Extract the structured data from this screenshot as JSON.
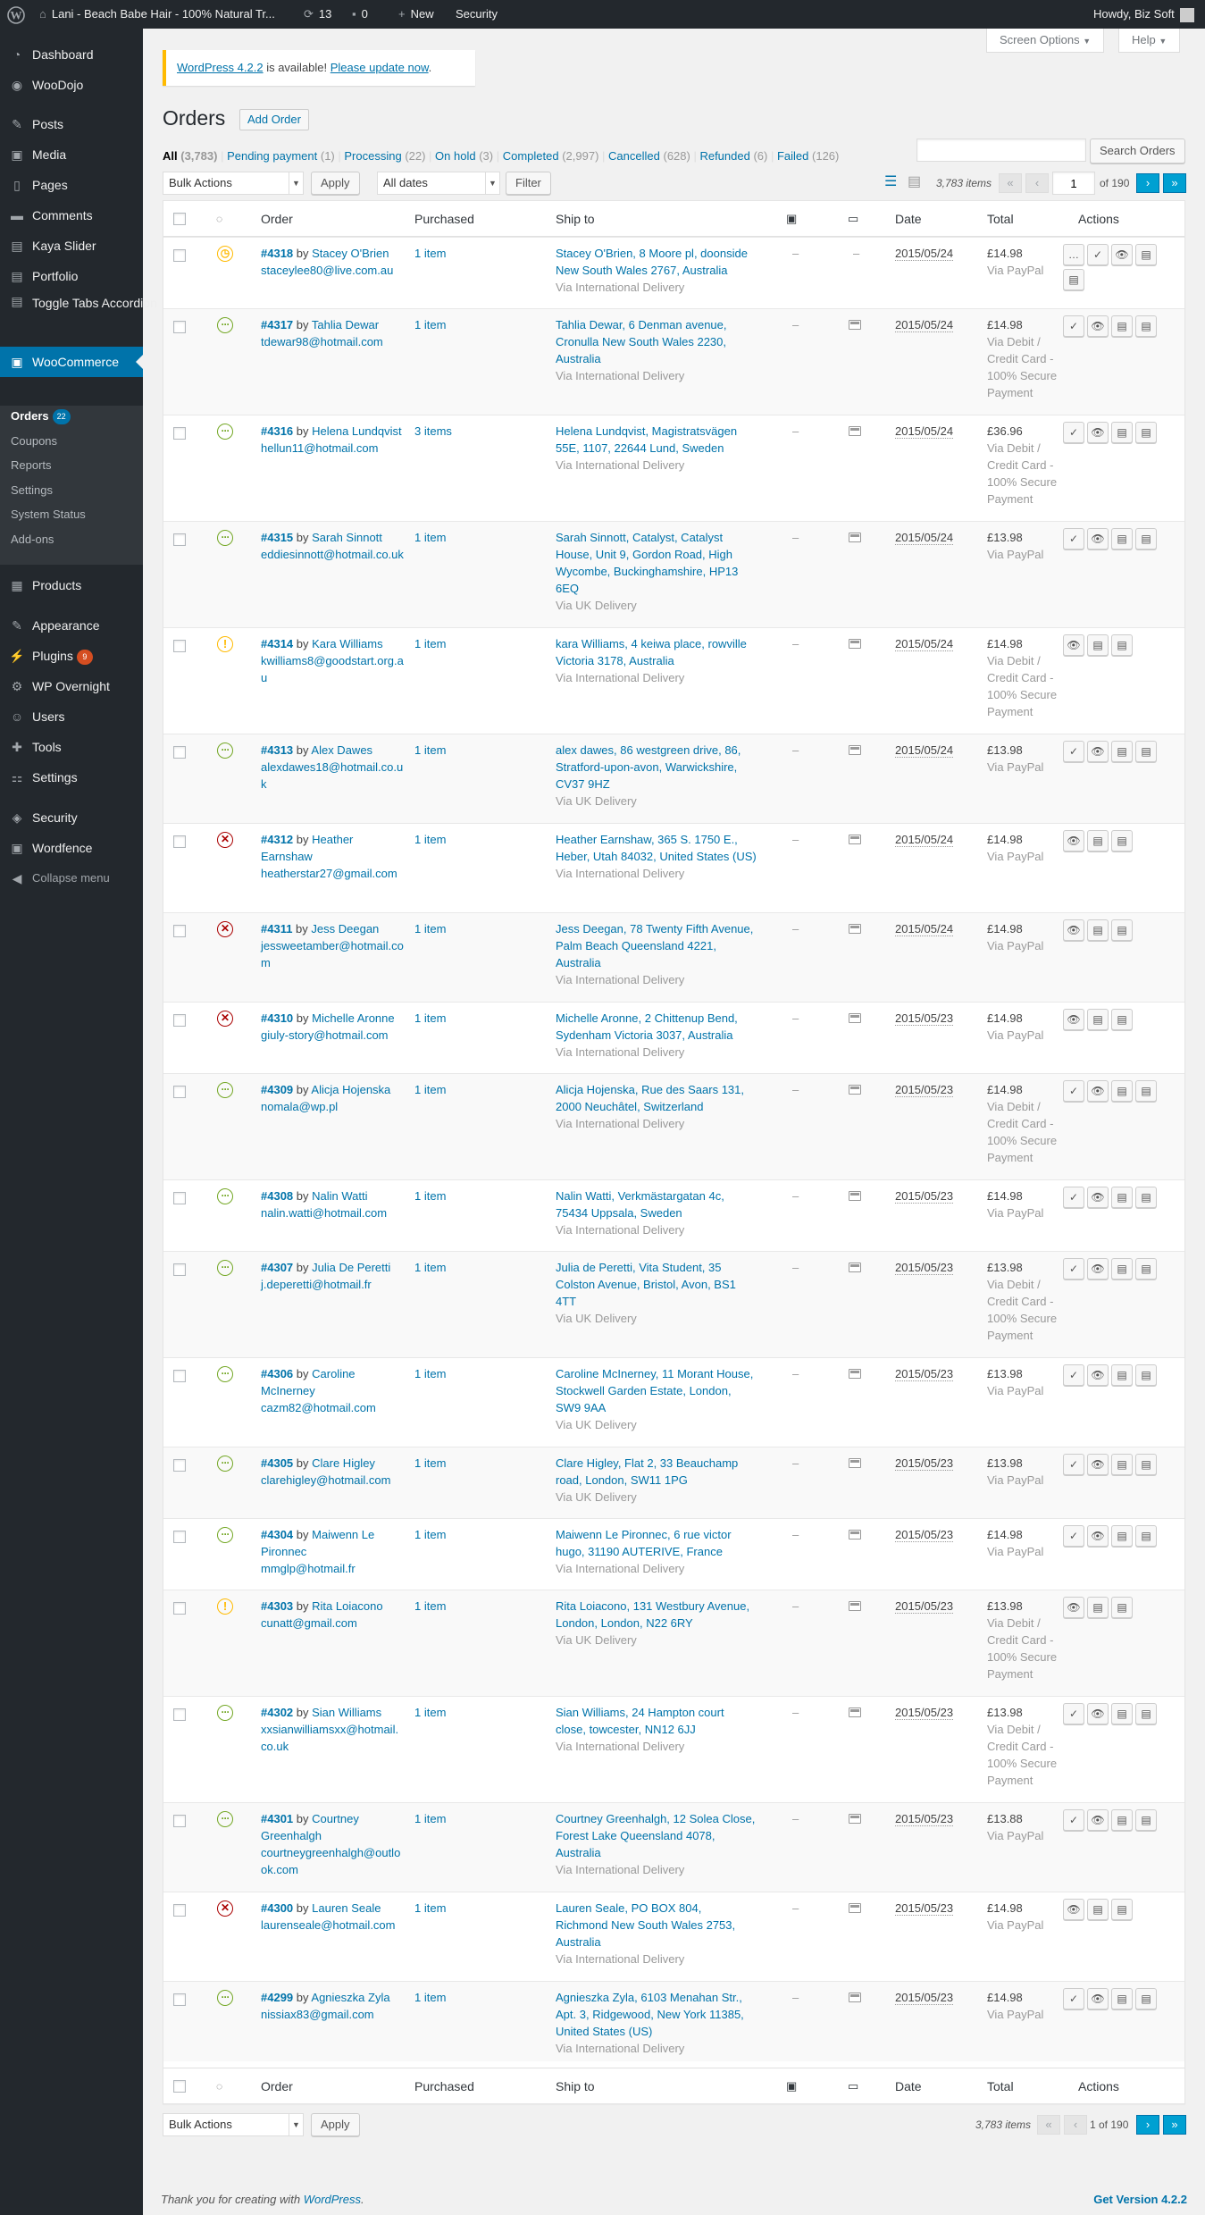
{
  "adminbar": {
    "site_name": "Lani - Beach Babe Hair - 100% Natural Tr...",
    "updates_count": "13",
    "comments_count": "0",
    "new_label": "New",
    "security_label": "Security",
    "howdy": "Howdy, Biz Soft"
  },
  "sidebar": {
    "dashboard": "Dashboard",
    "woodojo": "WooDojo",
    "posts": "Posts",
    "media": "Media",
    "pages": "Pages",
    "comments": "Comments",
    "kaya": "Kaya Slider",
    "portfolio": "Portfolio",
    "toggle_tabs": "Toggle Tabs Accordion",
    "woocommerce": "WooCommerce",
    "sub_orders": "Orders",
    "sub_orders_badge": "22",
    "sub_coupons": "Coupons",
    "sub_reports": "Reports",
    "sub_settings": "Settings",
    "sub_system": "System Status",
    "sub_addons": "Add-ons",
    "products": "Products",
    "appearance": "Appearance",
    "plugins": "Plugins",
    "plugins_badge": "9",
    "overnight": "WP Overnight",
    "users": "Users",
    "tools": "Tools",
    "settings": "Settings",
    "security": "Security",
    "wordfence": "Wordfence",
    "collapse": "Collapse menu"
  },
  "top": {
    "screen_options": "Screen Options",
    "help": "Help"
  },
  "notice": {
    "version_link": "WordPress 4.2.2",
    "text": " is available! ",
    "update_link": "Please update now",
    "end": "."
  },
  "page": {
    "title": "Orders",
    "add_order": "Add Order"
  },
  "filters": {
    "all": "All",
    "all_count": "(3,783)",
    "pending": "Pending payment",
    "pending_count": "(1)",
    "processing": "Processing",
    "processing_count": "(22)",
    "onhold": "On hold",
    "onhold_count": "(3)",
    "completed": "Completed",
    "completed_count": "(2,997)",
    "cancelled": "Cancelled",
    "cancelled_count": "(628)",
    "refunded": "Refunded",
    "refunded_count": "(6)",
    "failed": "Failed",
    "failed_count": "(126)"
  },
  "search": {
    "placeholder": "",
    "button": "Search Orders"
  },
  "toolbar": {
    "bulk_actions": "Bulk Actions",
    "apply": "Apply",
    "all_dates": "All dates",
    "filter": "Filter",
    "items": "3,783 items",
    "current_page": "1",
    "of_pages": "of 190",
    "bottom_pages": "1 of 190"
  },
  "columns": {
    "order": "Order",
    "purchased": "Purchased",
    "ship_to": "Ship to",
    "date": "Date",
    "total": "Total",
    "actions": "Actions"
  },
  "orders": [
    {
      "num": "#4318",
      "by": " by ",
      "name": "Stacey O'Brien",
      "email": "staceylee80@live.com.au",
      "purchased": "1 item",
      "ship": "Stacey O'Brien, 8 Moore pl, doonside New South Wales 2767, Australia",
      "via": "Via International Delivery",
      "date": "2015/05/24",
      "total": "£14.98",
      "method": "Via PayPal",
      "status": "pending",
      "icon": "◷",
      "note": "–",
      "actions": [
        "…",
        "✓",
        "👁",
        "▤",
        "▤"
      ]
    },
    {
      "num": "#4317",
      "by": " by ",
      "name": "Tahlia Dewar",
      "email": "tdewar98@hotmail.com",
      "purchased": "1 item",
      "ship": "Tahlia Dewar, 6 Denman avenue, Cronulla New South Wales 2230, Australia",
      "via": "Via International Delivery",
      "date": "2015/05/24",
      "total": "£14.98",
      "method": "Via Debit / Credit Card - 100% Secure Payment",
      "status": "processing",
      "icon": "···",
      "note": "icon",
      "actions": [
        "✓",
        "👁",
        "▤",
        "▤"
      ]
    },
    {
      "num": "#4316",
      "by": " by ",
      "name": "Helena Lundqvist",
      "email": "hellun11@hotmail.com",
      "purchased": "3 items",
      "ship": "Helena Lundqvist, Magistratsvägen 55E, 1107, 22644 Lund, Sweden",
      "via": "Via International Delivery",
      "date": "2015/05/24",
      "total": "£36.96",
      "method": "Via Debit / Credit Card - 100% Secure Payment",
      "status": "processing",
      "icon": "···",
      "note": "icon",
      "actions": [
        "✓",
        "👁",
        "▤",
        "▤"
      ]
    },
    {
      "num": "#4315",
      "by": " by ",
      "name": "Sarah Sinnott",
      "email": "eddiesinnott@hotmail.co.uk",
      "purchased": "1 item",
      "ship": "Sarah Sinnott, Catalyst, Catalyst House, Unit 9, Gordon Road, High Wycombe, Buckinghamshire, HP13 6EQ",
      "via": "Via UK Delivery",
      "date": "2015/05/24",
      "total": "£13.98",
      "method": "Via PayPal",
      "status": "processing",
      "icon": "···",
      "note": "icon",
      "actions": [
        "✓",
        "👁",
        "▤",
        "▤"
      ]
    },
    {
      "num": "#4314",
      "by": " by ",
      "name": "Kara Williams",
      "email": "kwilliams8@goodstart.org.au",
      "purchased": "1 item",
      "ship": "kara Williams, 4 keiwa place, rowville Victoria 3178, Australia",
      "via": "Via International Delivery",
      "date": "2015/05/24",
      "total": "£14.98",
      "method": "Via Debit / Credit Card - 100% Secure Payment",
      "status": "pay",
      "icon": "!",
      "note": "icon",
      "actions": [
        "👁",
        "▤",
        "▤"
      ]
    },
    {
      "num": "#4313",
      "by": " by ",
      "name": "Alex Dawes",
      "email": "alexdawes18@hotmail.co.uk",
      "purchased": "1 item",
      "ship": "alex dawes, 86 westgreen drive, 86, Stratford-upon-avon, Warwickshire, CV37 9HZ",
      "via": "Via UK Delivery",
      "date": "2015/05/24",
      "total": "£13.98",
      "method": "Via PayPal",
      "status": "processing",
      "icon": "···",
      "note": "icon",
      "actions": [
        "✓",
        "👁",
        "▤",
        "▤"
      ]
    },
    {
      "num": "#4312",
      "by": " by ",
      "name": "Heather Earnshaw",
      "email": "heatherstar27@gmail.com",
      "purchased": "1 item",
      "ship": "Heather Earnshaw, 365 S. 1750 E., Heber, Utah 84032, United States (US)",
      "via": "Via International Delivery",
      "date": "2015/05/24",
      "total": "£14.98",
      "method": "Via PayPal",
      "status": "cancelled",
      "icon": "✕",
      "note": "icon",
      "actions": [
        "👁",
        "▤",
        "▤"
      ]
    },
    {
      "num": "#4311",
      "by": " by ",
      "name": "Jess Deegan",
      "email": "jessweetamber@hotmail.com",
      "purchased": "1 item",
      "ship": "Jess Deegan, 78 Twenty Fifth Avenue, Palm Beach Queensland 4221, Australia",
      "via": "Via International Delivery",
      "date": "2015/05/24",
      "total": "£14.98",
      "method": "Via PayPal",
      "status": "cancelled",
      "icon": "✕",
      "note": "icon",
      "actions": [
        "👁",
        "▤",
        "▤"
      ]
    },
    {
      "num": "#4310",
      "by": " by ",
      "name": "Michelle Aronne",
      "email": "giuly-story@hotmail.com",
      "purchased": "1 item",
      "ship": "Michelle Aronne, 2 Chittenup Bend, Sydenham Victoria 3037, Australia",
      "via": "Via International Delivery",
      "date": "2015/05/23",
      "total": "£14.98",
      "method": "Via PayPal",
      "status": "cancelled",
      "icon": "✕",
      "note": "icon",
      "actions": [
        "👁",
        "▤",
        "▤"
      ]
    },
    {
      "num": "#4309",
      "by": " by ",
      "name": "Alicja Hojenska",
      "email": "nomala@wp.pl",
      "purchased": "1 item",
      "ship": "Alicja Hojenska, Rue des Saars 131, 2000 Neuchâtel, Switzerland",
      "via": "Via International Delivery",
      "date": "2015/05/23",
      "total": "£14.98",
      "method": "Via Debit / Credit Card - 100% Secure Payment",
      "status": "processing",
      "icon": "···",
      "note": "icon",
      "actions": [
        "✓",
        "👁",
        "▤",
        "▤"
      ]
    },
    {
      "num": "#4308",
      "by": " by ",
      "name": "Nalin Watti",
      "email": "nalin.watti@hotmail.com",
      "purchased": "1 item",
      "ship": "Nalin Watti, Verkmästargatan 4c, 75434 Uppsala, Sweden",
      "via": "Via International Delivery",
      "date": "2015/05/23",
      "total": "£14.98",
      "method": "Via PayPal",
      "status": "processing",
      "icon": "···",
      "note": "icon",
      "actions": [
        "✓",
        "👁",
        "▤",
        "▤"
      ]
    },
    {
      "num": "#4307",
      "by": " by ",
      "name": "Julia De Peretti",
      "email": "j.deperetti@hotmail.fr",
      "purchased": "1 item",
      "ship": "Julia de Peretti, Vita Student, 35 Colston Avenue, Bristol, Avon, BS1 4TT",
      "via": "Via UK Delivery",
      "date": "2015/05/23",
      "total": "£13.98",
      "method": "Via Debit / Credit Card - 100% Secure Payment",
      "status": "processing",
      "icon": "···",
      "note": "icon",
      "actions": [
        "✓",
        "👁",
        "▤",
        "▤"
      ]
    },
    {
      "num": "#4306",
      "by": " by ",
      "name": "Caroline McInerney",
      "email": "cazm82@hotmail.com",
      "purchased": "1 item",
      "ship": "Caroline McInerney, 11 Morant House, Stockwell Garden Estate, London, SW9 9AA",
      "via": "Via UK Delivery",
      "date": "2015/05/23",
      "total": "£13.98",
      "method": "Via PayPal",
      "status": "processing",
      "icon": "···",
      "note": "icon",
      "actions": [
        "✓",
        "👁",
        "▤",
        "▤"
      ]
    },
    {
      "num": "#4305",
      "by": " by ",
      "name": "Clare Higley",
      "email": "clarehigley@hotmail.com",
      "purchased": "1 item",
      "ship": "Clare Higley, Flat 2, 33 Beauchamp road, London, SW11 1PG",
      "via": "Via UK Delivery",
      "date": "2015/05/23",
      "total": "£13.98",
      "method": "Via PayPal",
      "status": "processing",
      "icon": "···",
      "note": "icon",
      "actions": [
        "✓",
        "👁",
        "▤",
        "▤"
      ]
    },
    {
      "num": "#4304",
      "by": " by ",
      "name": "Maiwenn Le Pironnec",
      "email": "mmglp@hotmail.fr",
      "purchased": "1 item",
      "ship": "Maiwenn Le Pironnec, 6 rue victor hugo, 31190 AUTERIVE, France",
      "via": "Via International Delivery",
      "date": "2015/05/23",
      "total": "£14.98",
      "method": "Via PayPal",
      "status": "processing",
      "icon": "···",
      "note": "icon",
      "actions": [
        "✓",
        "👁",
        "▤",
        "▤"
      ]
    },
    {
      "num": "#4303",
      "by": " by ",
      "name": "Rita Loiacono",
      "email": "cunatt@gmail.com",
      "purchased": "1 item",
      "ship": "Rita Loiacono, 131 Westbury Avenue, London, London, N22 6RY",
      "via": "Via UK Delivery",
      "date": "2015/05/23",
      "total": "£13.98",
      "method": "Via Debit / Credit Card - 100% Secure Payment",
      "status": "pay",
      "icon": "!",
      "note": "icon",
      "actions": [
        "👁",
        "▤",
        "▤"
      ]
    },
    {
      "num": "#4302",
      "by": " by ",
      "name": "Sian Williams",
      "email": "xxsianwilliamsxx@hotmail.co.uk",
      "purchased": "1 item",
      "ship": "Sian Williams, 24 Hampton court close, towcester, NN12 6JJ",
      "via": "Via International Delivery",
      "date": "2015/05/23",
      "total": "£13.98",
      "method": "Via Debit / Credit Card - 100% Secure Payment",
      "status": "processing",
      "icon": "···",
      "note": "icon",
      "actions": [
        "✓",
        "👁",
        "▤",
        "▤"
      ]
    },
    {
      "num": "#4301",
      "by": " by ",
      "name": "Courtney Greenhalgh",
      "email": "courtneygreenhalgh@outlook.com",
      "purchased": "1 item",
      "ship": "Courtney Greenhalgh, 12 Solea Close, Forest Lake Queensland 4078, Australia",
      "via": "Via International Delivery",
      "date": "2015/05/23",
      "total": "£13.88",
      "method": "Via PayPal",
      "status": "processing",
      "icon": "···",
      "note": "icon",
      "actions": [
        "✓",
        "👁",
        "▤",
        "▤"
      ]
    },
    {
      "num": "#4300",
      "by": " by ",
      "name": "Lauren Seale",
      "email": "laurenseale@hotmail.com",
      "purchased": "1 item",
      "ship": "Lauren Seale, PO BOX 804, Richmond New South Wales 2753, Australia",
      "via": "Via International Delivery",
      "date": "2015/05/23",
      "total": "£14.98",
      "method": "Via PayPal",
      "status": "cancelled",
      "icon": "✕",
      "note": "icon",
      "actions": [
        "👁",
        "▤",
        "▤"
      ]
    },
    {
      "num": "#4299",
      "by": " by ",
      "name": "Agnieszka Zyla",
      "email": "nissiax83@gmail.com",
      "purchased": "1 item",
      "ship": "Agnieszka Zyla, 6103 Menahan Str., Apt. 3, Ridgewood, New York 11385, United States (US)",
      "via": "Via International Delivery",
      "date": "2015/05/23",
      "total": "£14.98",
      "method": "Via PayPal",
      "status": "processing",
      "icon": "···",
      "note": "icon",
      "actions": [
        "✓",
        "👁",
        "▤",
        "▤"
      ]
    }
  ],
  "footer": {
    "thanks": "Thank you for creating with ",
    "wp": "WordPress",
    "end": ".",
    "version": "Get Version 4.2.2"
  },
  "colors": {
    "accent": "#0073aa",
    "menu_bg": "#23282d",
    "notice": "#ffba00",
    "badge": "#d54e21"
  }
}
